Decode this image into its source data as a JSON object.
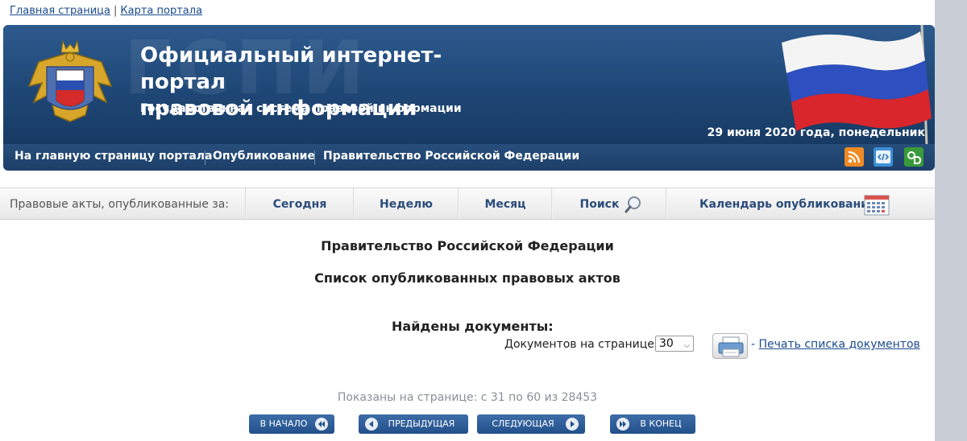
{
  "top_links": {
    "home": "Главная страница",
    "separator": "|",
    "sitemap": "Карта портала"
  },
  "header": {
    "watermark": "ГСПИ",
    "title_line1": "Официальный интернет-портал",
    "title_line2": "правовой информации",
    "subtitle": "Государственная система правовой информации",
    "date": "29 июня 2020 года, понедельник"
  },
  "main_nav": {
    "items": [
      "На главную страницу портала",
      "Опубликование",
      "Правительство Российской Федерации"
    ],
    "icons": [
      "rss-icon",
      "code-icon",
      "open-data-icon"
    ],
    "icon_colors": {
      "rss": "#f08a24",
      "code": "#3b8fd8",
      "open_data": "#3a9a3a"
    }
  },
  "sub_nav": {
    "label": "Правовые акты, опубликованные за:",
    "tabs": [
      "Сегодня",
      "Неделю",
      "Месяц",
      "Поиск",
      "Календарь опубликования"
    ]
  },
  "content": {
    "heading": "Правительство Российской Федерации",
    "subheading": "Список опубликованных правовых актов",
    "found": "Найдены документы:",
    "per_page_label": "Документов на странице:",
    "per_page_value": "30",
    "print_prefix": "-",
    "print_link": "Печать списка документов",
    "shown_text": "Показаны на странице: с 31 по 60 из 28453"
  },
  "pagination": {
    "first": "В НАЧАЛО",
    "prev": "ПРЕДЫДУЩАЯ",
    "next": "СЛЕДУЮЩАЯ",
    "last": "В КОНЕЦ"
  },
  "colors": {
    "header_bg": "#1f4776",
    "link": "#1a4a8f",
    "button_bg": "#22508a"
  }
}
